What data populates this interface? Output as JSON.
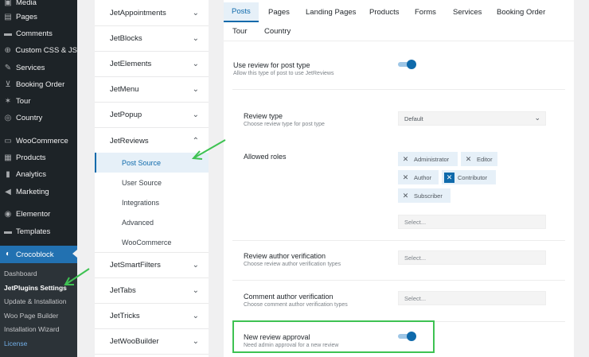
{
  "admin_menu": [
    {
      "icon": "media-icon",
      "glyph": "▣",
      "label": "Media"
    },
    {
      "icon": "pages-icon",
      "glyph": "▤",
      "label": "Pages"
    },
    {
      "icon": "comments-icon",
      "glyph": "▬",
      "label": "Comments"
    },
    {
      "icon": "plus-icon",
      "glyph": "⊕",
      "label": "Custom CSS & JS"
    },
    {
      "icon": "pin-icon",
      "glyph": "✎",
      "label": "Services"
    },
    {
      "icon": "cart-icon",
      "glyph": "⊻",
      "label": "Booking Order"
    },
    {
      "icon": "tour-pin-icon",
      "glyph": "✶",
      "label": "Tour"
    },
    {
      "icon": "globe-icon",
      "glyph": "◎",
      "label": "Country"
    },
    {
      "icon": "woocommerce-icon",
      "glyph": "▭",
      "label": "WooCommerce"
    },
    {
      "icon": "products-icon",
      "glyph": "▦",
      "label": "Products"
    },
    {
      "icon": "analytics-icon",
      "glyph": "▮",
      "label": "Analytics"
    },
    {
      "icon": "megaphone-icon",
      "glyph": "◀",
      "label": "Marketing"
    },
    {
      "icon": "elementor-icon",
      "glyph": "◉",
      "label": "Elementor"
    },
    {
      "icon": "templates-icon",
      "glyph": "▬",
      "label": "Templates"
    },
    {
      "icon": "crocoblock-icon",
      "glyph": "◐",
      "label": "Crocoblock"
    }
  ],
  "admin_submenu": [
    "Dashboard",
    "JetPlugins Settings",
    "Update & Installation",
    "Woo Page Builder",
    "Installation Wizard",
    "License"
  ],
  "plugins": {
    "top": [
      "JetAppointments",
      "JetBlocks",
      "JetElements",
      "JetMenu",
      "JetPopup",
      "JetReviews"
    ],
    "jetreviews_sub": [
      "Post Source",
      "User Source",
      "Integrations",
      "Advanced",
      "WooCommerce"
    ],
    "bottom": [
      "JetSmartFilters",
      "JetTabs",
      "JetTricks",
      "JetWooBuilder"
    ]
  },
  "tabs": [
    "Posts",
    "Pages",
    "Landing Pages",
    "Products",
    "Forms",
    "Services",
    "Booking Order",
    "Tour",
    "Country"
  ],
  "settings": {
    "use_review": {
      "label": "Use review for post type",
      "desc": "Allow this type of post to use JetReviews",
      "enabled": true
    },
    "review_type": {
      "label": "Review type",
      "desc": "Choose review type for post type",
      "value": "Default"
    },
    "allowed_roles": {
      "label": "Allowed roles",
      "roles": [
        {
          "name": "Administrator",
          "checked": false
        },
        {
          "name": "Editor",
          "checked": false
        },
        {
          "name": "Author",
          "checked": false
        },
        {
          "name": "Contributor",
          "checked": true
        },
        {
          "name": "Subscriber",
          "checked": false
        }
      ],
      "placeholder": "Select..."
    },
    "review_author_verification": {
      "label": "Review author verification",
      "desc": "Choose review author verification types",
      "placeholder": "Select..."
    },
    "comment_author_verification": {
      "label": "Comment author verification",
      "desc": "Choose comment author verification types",
      "placeholder": "Select..."
    },
    "new_review_approval": {
      "label": "New review approval",
      "desc": "Need admin approval for a new review",
      "enabled": true
    }
  },
  "colors": {
    "accent": "#0f6aab",
    "highlight": "#3ec252",
    "admin_bg": "#1d2327",
    "admin_active": "#2271b1"
  }
}
